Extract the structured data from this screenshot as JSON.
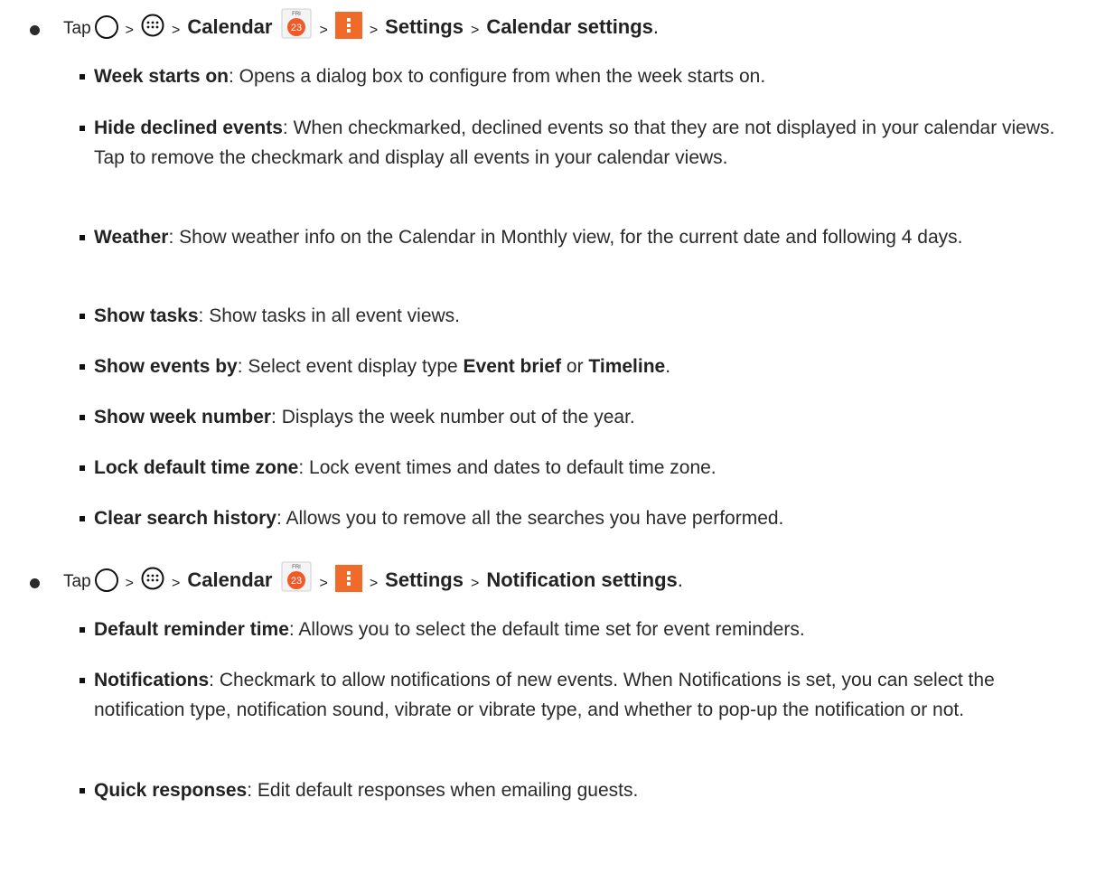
{
  "sections": [
    {
      "tap": "Tap",
      "sep": ">",
      "calendar": "Calendar",
      "cal_icon_day": "FRI",
      "cal_icon_date": "23",
      "settings": "Settings",
      "target": "Calendar settings",
      "end": ".",
      "items": [
        {
          "term": "Week starts on",
          "desc": ": Opens a dialog box to configure from when the week starts on."
        },
        {
          "term": "Hide declined events",
          "desc": ": When checkmarked, declined events so that they are not displayed in your calendar views. Tap to remove the checkmark and display all events in your calendar views."
        },
        {
          "term": "Weather",
          "desc": ": Show weather info on the Calendar in Monthly view, for the current date and following 4 days."
        },
        {
          "term": "Show tasks",
          "desc": ": Show tasks in all event views."
        },
        {
          "term": "Show events by",
          "desc": ": Select event display type ",
          "b2": "Event brief",
          "mid": " or ",
          "b3": "Timeline",
          "tail": "."
        },
        {
          "term": "Show week number",
          "desc": ": Displays the week number out of the year."
        },
        {
          "term": "Lock default time zone",
          "desc": ": Lock event times and dates to default time zone."
        },
        {
          "term": "Clear search history",
          "desc": ": Allows you to remove all the searches you have performed."
        }
      ]
    },
    {
      "tap": "Tap",
      "sep": ">",
      "calendar": "Calendar",
      "cal_icon_day": "FRI",
      "cal_icon_date": "23",
      "settings": "Settings",
      "target": "Notification settings",
      "end": ".",
      "items": [
        {
          "term": "Default reminder time",
          "desc": ": Allows you to select the default time set for event reminders."
        },
        {
          "term": "Notifications",
          "desc": ": Checkmark to allow notifications of new events. When Notifications is set, you can select the notification type, notification sound, vibrate or vibrate type, and whether to pop-up the notification or not."
        },
        {
          "term": "Quick responses",
          "desc": ": Edit default responses when emailing guests."
        }
      ]
    }
  ]
}
